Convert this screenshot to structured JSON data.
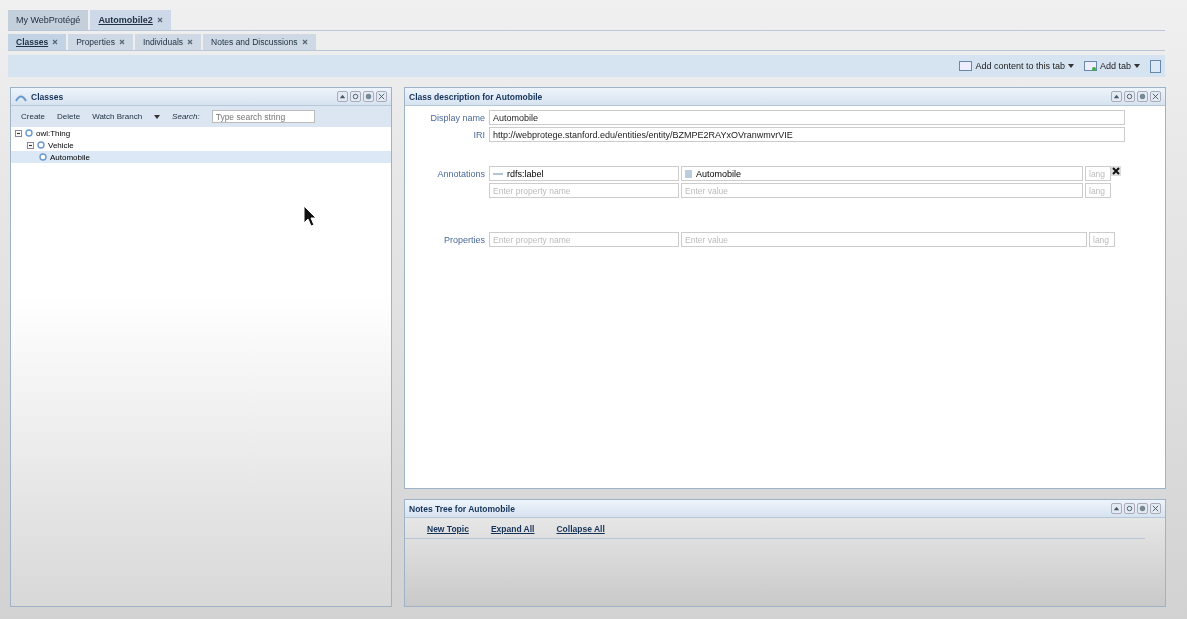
{
  "project_tabs": [
    {
      "label": "My WebProtégé",
      "selected": false,
      "closable": false
    },
    {
      "label": "Automobile2",
      "selected": true,
      "closable": true
    }
  ],
  "tabs": [
    {
      "label": "Classes",
      "selected": true
    },
    {
      "label": "Properties",
      "selected": false
    },
    {
      "label": "Individuals",
      "selected": false
    },
    {
      "label": "Notes and Discussions",
      "selected": false
    }
  ],
  "toolbar": {
    "add_content": "Add content to this tab",
    "add_tab": "Add tab"
  },
  "classes_panel": {
    "title": "Classes",
    "actions": [
      "Create",
      "Delete",
      "Watch Branch"
    ],
    "search_label": "Search:",
    "search_placeholder": "Type search string",
    "tree": [
      {
        "label": "owl:Thing",
        "selected": false,
        "expanded": true,
        "children": [
          {
            "label": "Vehicle",
            "selected": false,
            "expanded": true,
            "children": [
              {
                "label": "Automobile",
                "selected": true
              }
            ]
          }
        ]
      }
    ]
  },
  "description_panel": {
    "title": "Class description for Automobile",
    "display_name_label": "Display name",
    "display_name": "Automobile",
    "iri_label": "IRI",
    "iri": "http://webprotege.stanford.edu/entities/entity/BZMPE2RAYxOVranwmvrVIE",
    "annotations_label": "Annotations",
    "annotations": [
      {
        "property": "rdfs:label",
        "value": "Automobile",
        "lang_placeholder": "lang"
      }
    ],
    "new_annotation": {
      "property_placeholder": "Enter property name",
      "value_placeholder": "Enter value",
      "lang_placeholder": "lang"
    },
    "properties_label": "Properties",
    "new_property": {
      "property_placeholder": "Enter property name",
      "value_placeholder": "Enter value",
      "lang_placeholder": "lang"
    }
  },
  "notes_panel": {
    "title": "Notes Tree for Automobile",
    "links": [
      "New Topic",
      "Expand All",
      "Collapse All"
    ]
  }
}
